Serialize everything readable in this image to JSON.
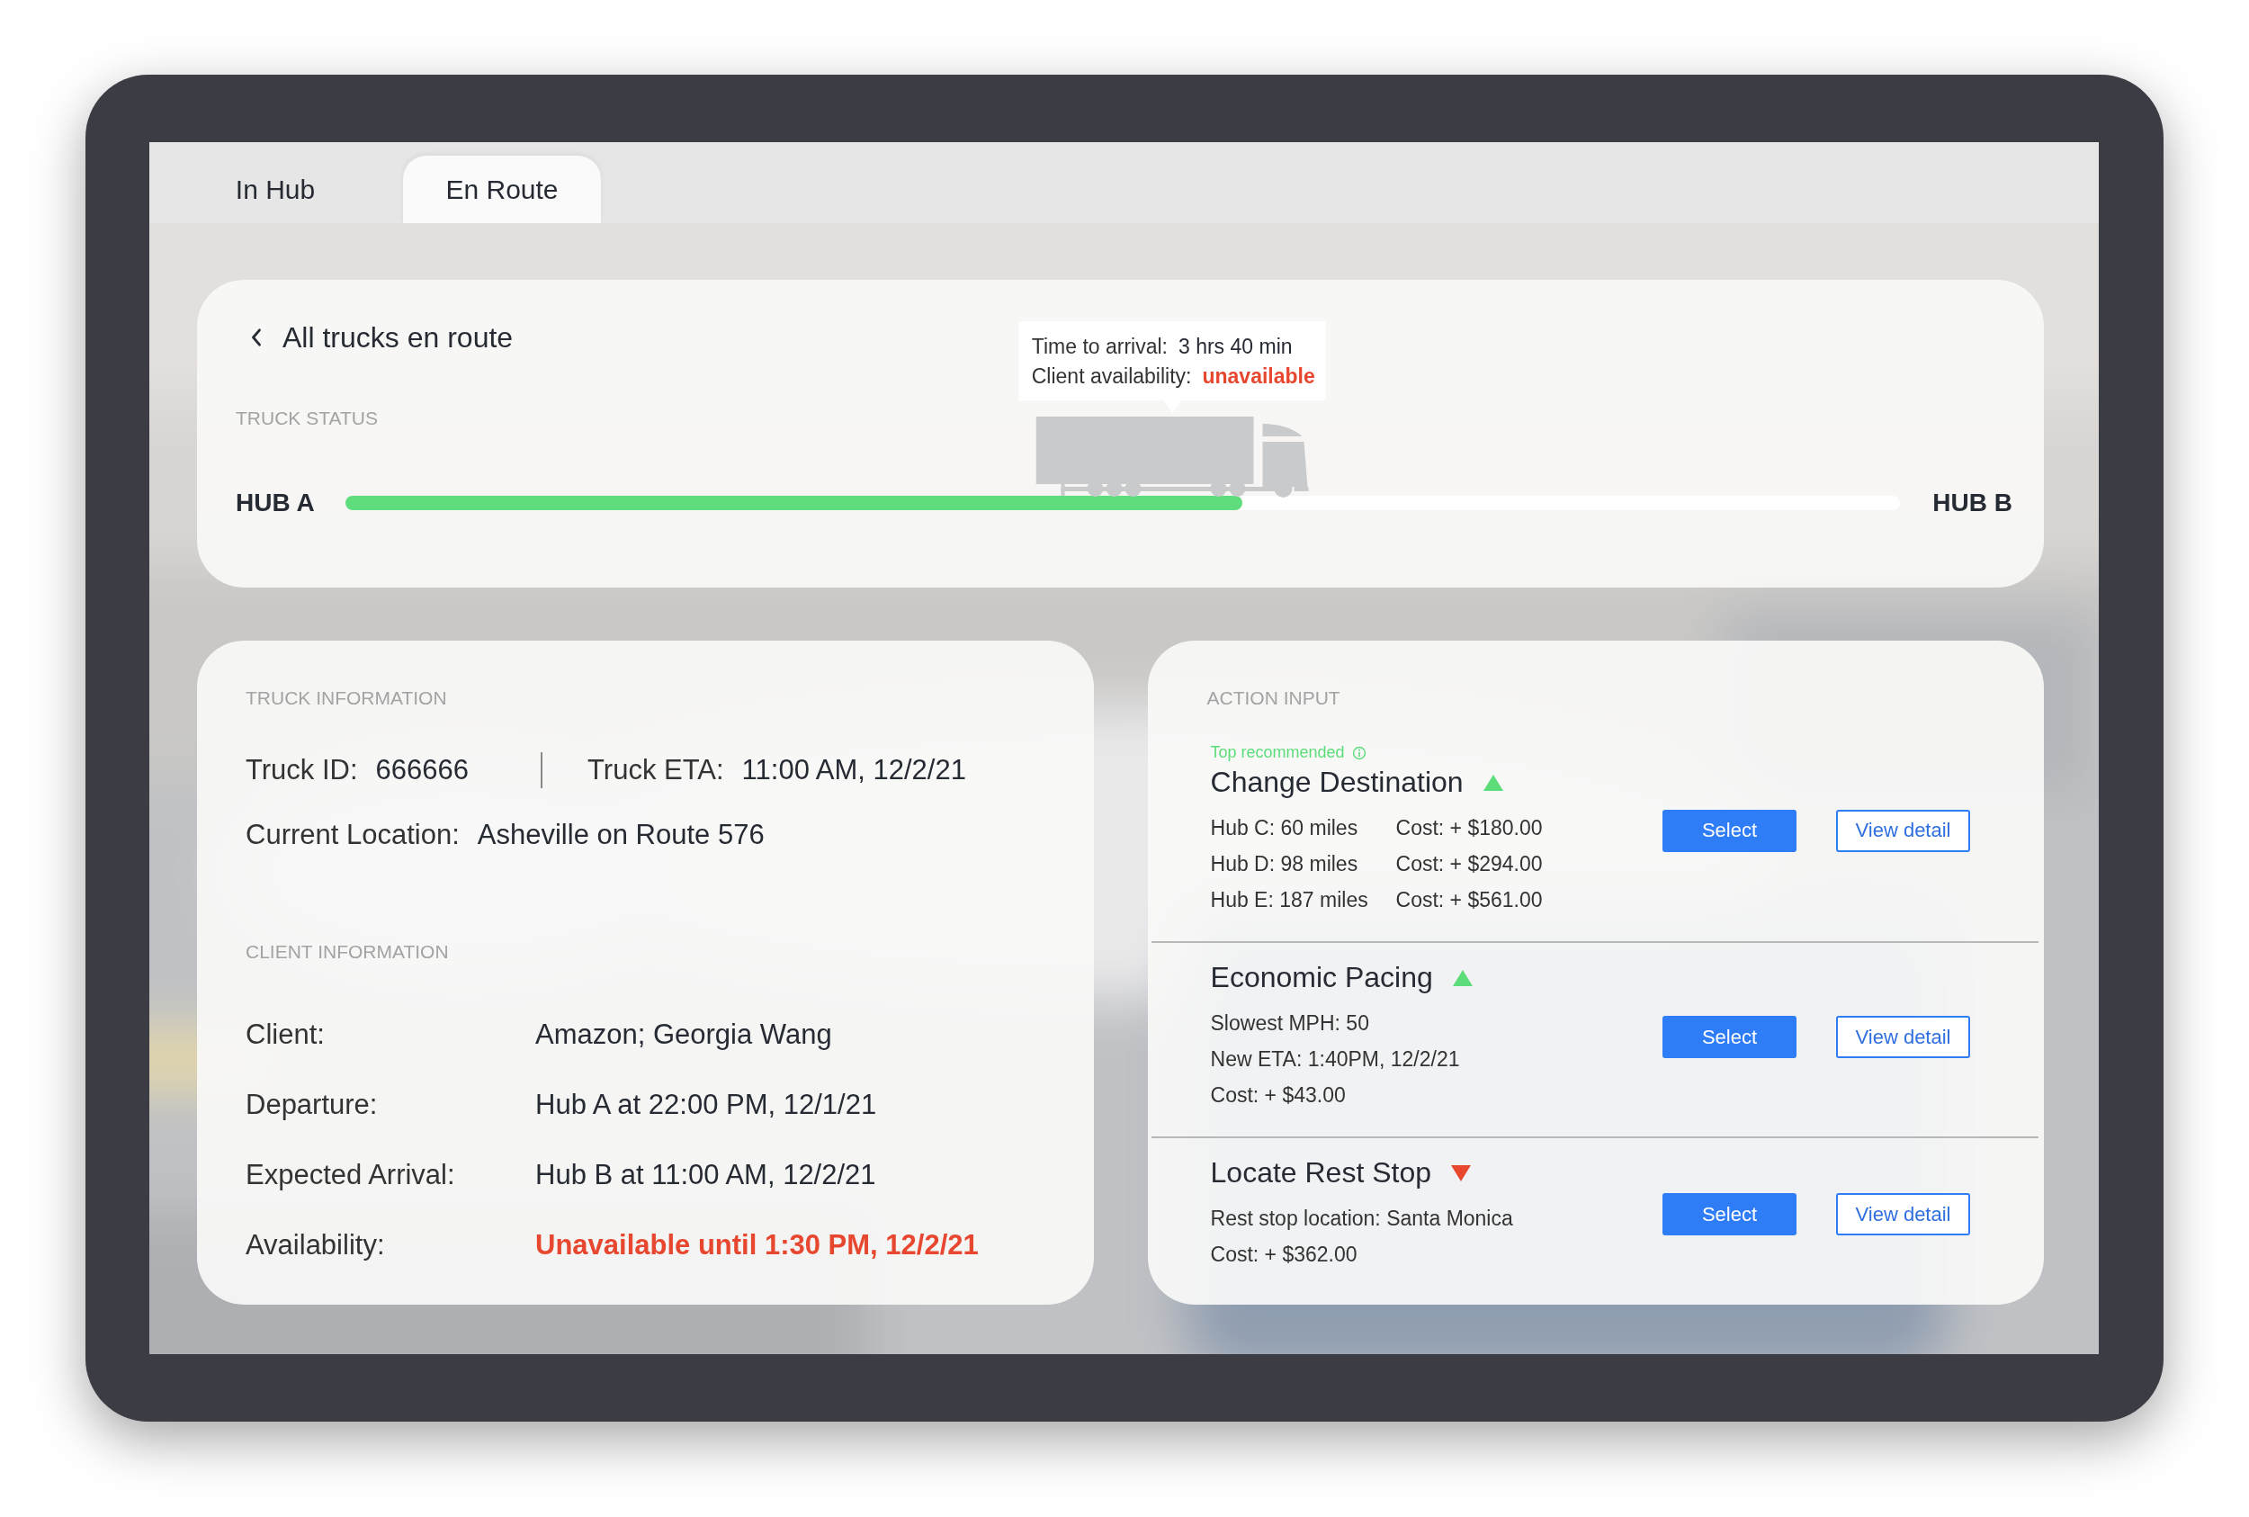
{
  "tabs": [
    {
      "label": "In Hub",
      "selected": false
    },
    {
      "label": "En Route",
      "selected": true
    }
  ],
  "status": {
    "back_label": "All trucks en route",
    "section": "TRUCK STATUS",
    "origin": "HUB A",
    "destination": "HUB B",
    "level": 0.577,
    "tooltip": [
      {
        "label": "Time to arrival:",
        "value": "3 hrs 40 min",
        "kind": "normal"
      },
      {
        "label": "Client availability:",
        "value": "unavailable",
        "kind": "alert"
      }
    ]
  },
  "truck_info": {
    "section": "TRUCK INFORMATION",
    "id": {
      "label": "Truck ID:",
      "value": "666666"
    },
    "eta": {
      "label": "Truck ETA:",
      "value": "11:00 AM, 12/2/21"
    },
    "location": {
      "label": "Current Location:",
      "value": "Asheville on Route 576"
    }
  },
  "client_info": {
    "section": "CLIENT INFORMATION",
    "rows": [
      {
        "label": "Client:",
        "value": "Amazon; Georgia Wang",
        "kind": "normal"
      },
      {
        "label": "Departure:",
        "value": "Hub A at 22:00 PM, 12/1/21",
        "kind": "normal"
      },
      {
        "label": "Expected Arrival:",
        "value": "Hub B at 11:00 AM, 12/2/21",
        "kind": "normal"
      },
      {
        "label": "Availability:",
        "value": "Unavailable until 1:30 PM, 12/2/21",
        "kind": "alert"
      }
    ]
  },
  "action_input": {
    "section": "ACTION INPUT",
    "actions": [
      {
        "badge": "Top recommended",
        "title": "Change Destination",
        "trend_up": true,
        "lines": [
          [
            "Hub C: 60 miles",
            "Cost: + $180.00"
          ],
          [
            "Hub D: 98 miles",
            "Cost: + $294.00"
          ],
          [
            "Hub E: 187 miles",
            "Cost: + $561.00"
          ]
        ],
        "buttons": [
          "Select",
          "View detail"
        ]
      },
      {
        "title": "Economic Pacing",
        "trend_up": true,
        "lines": [
          [
            "Slowest MPH: 50"
          ],
          [
            "New ETA: 1:40PM, 12/2/21"
          ],
          [
            "Cost: + $43.00"
          ]
        ],
        "buttons": [
          "Select",
          "View detail"
        ]
      },
      {
        "title": "Locate Rest Stop",
        "trend_up": false,
        "lines": [
          [
            "Rest stop location: Santa Monica"
          ],
          [
            "Cost: + $362.00"
          ]
        ],
        "buttons": [
          "Select",
          "View detail"
        ]
      }
    ]
  }
}
